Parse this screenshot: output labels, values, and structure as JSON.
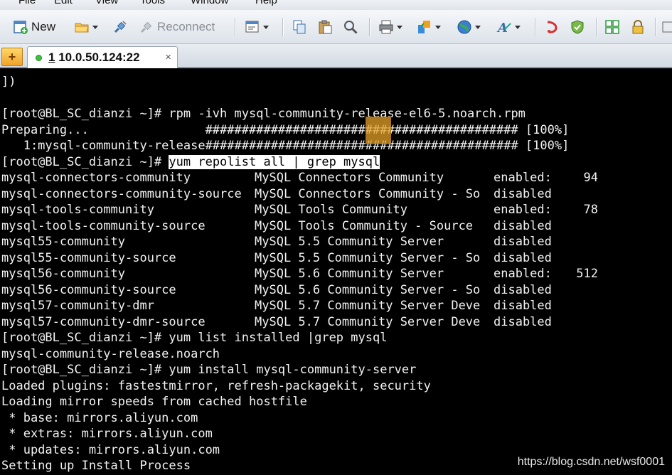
{
  "menu": {
    "items": [
      "File",
      "Edit",
      "View",
      "Tools",
      "Window",
      "Help"
    ]
  },
  "toolbar": {
    "new_label": "New",
    "reconnect_label": "Reconnect"
  },
  "tabs": [
    {
      "index": "1",
      "label": "10.0.50.124:22",
      "status_color": "#3cc23c"
    }
  ],
  "terminal": {
    "lines": [
      "])",
      "",
      "[root@BL_SC_dianzi ~]# rpm -ivh mysql-community-release-el6-5.noarch.rpm",
      "Preparing...                ########################################### [100%]",
      "   1:mysql-community-release########################################### [100%]"
    ],
    "prompt": "[root@BL_SC_dianzi ~]# ",
    "highlighted_command": "yum repolist all | grep mysql",
    "repos": [
      {
        "id": "mysql-connectors-community",
        "name": "MySQL Connectors Community",
        "status": "enabled:",
        "count": "94"
      },
      {
        "id": "mysql-connectors-community-source",
        "name": "MySQL Connectors Community - So",
        "status": "disabled",
        "count": ""
      },
      {
        "id": "mysql-tools-community",
        "name": "MySQL Tools Community",
        "status": "enabled:",
        "count": "78"
      },
      {
        "id": "mysql-tools-community-source",
        "name": "MySQL Tools Community - Source",
        "status": "disabled",
        "count": ""
      },
      {
        "id": "mysql55-community",
        "name": "MySQL 5.5 Community Server",
        "status": "disabled",
        "count": ""
      },
      {
        "id": "mysql55-community-source",
        "name": "MySQL 5.5 Community Server - So",
        "status": "disabled",
        "count": ""
      },
      {
        "id": "mysql56-community",
        "name": "MySQL 5.6 Community Server",
        "status": "enabled:",
        "count": "512"
      },
      {
        "id": "mysql56-community-source",
        "name": "MySQL 5.6 Community Server - So",
        "status": "disabled",
        "count": ""
      },
      {
        "id": "mysql57-community-dmr",
        "name": "MySQL 5.7 Community Server Deve",
        "status": "disabled",
        "count": ""
      },
      {
        "id": "mysql57-community-dmr-source",
        "name": "MySQL 5.7 Community Server Deve",
        "status": "disabled",
        "count": ""
      }
    ],
    "after_lines": [
      "[root@BL_SC_dianzi ~]# yum list installed |grep mysql",
      "mysql-community-release.noarch",
      "[root@BL_SC_dianzi ~]# yum install mysql-community-server",
      "Loaded plugins: fastestmirror, refresh-packagekit, security",
      "Loading mirror speeds from cached hostfile",
      " * base: mirrors.aliyun.com",
      " * extras: mirrors.aliyun.com",
      " * updates: mirrors.aliyun.com",
      "Setting up Install Process"
    ]
  },
  "watermark": "https://blog.csdn.net/wsf0001"
}
